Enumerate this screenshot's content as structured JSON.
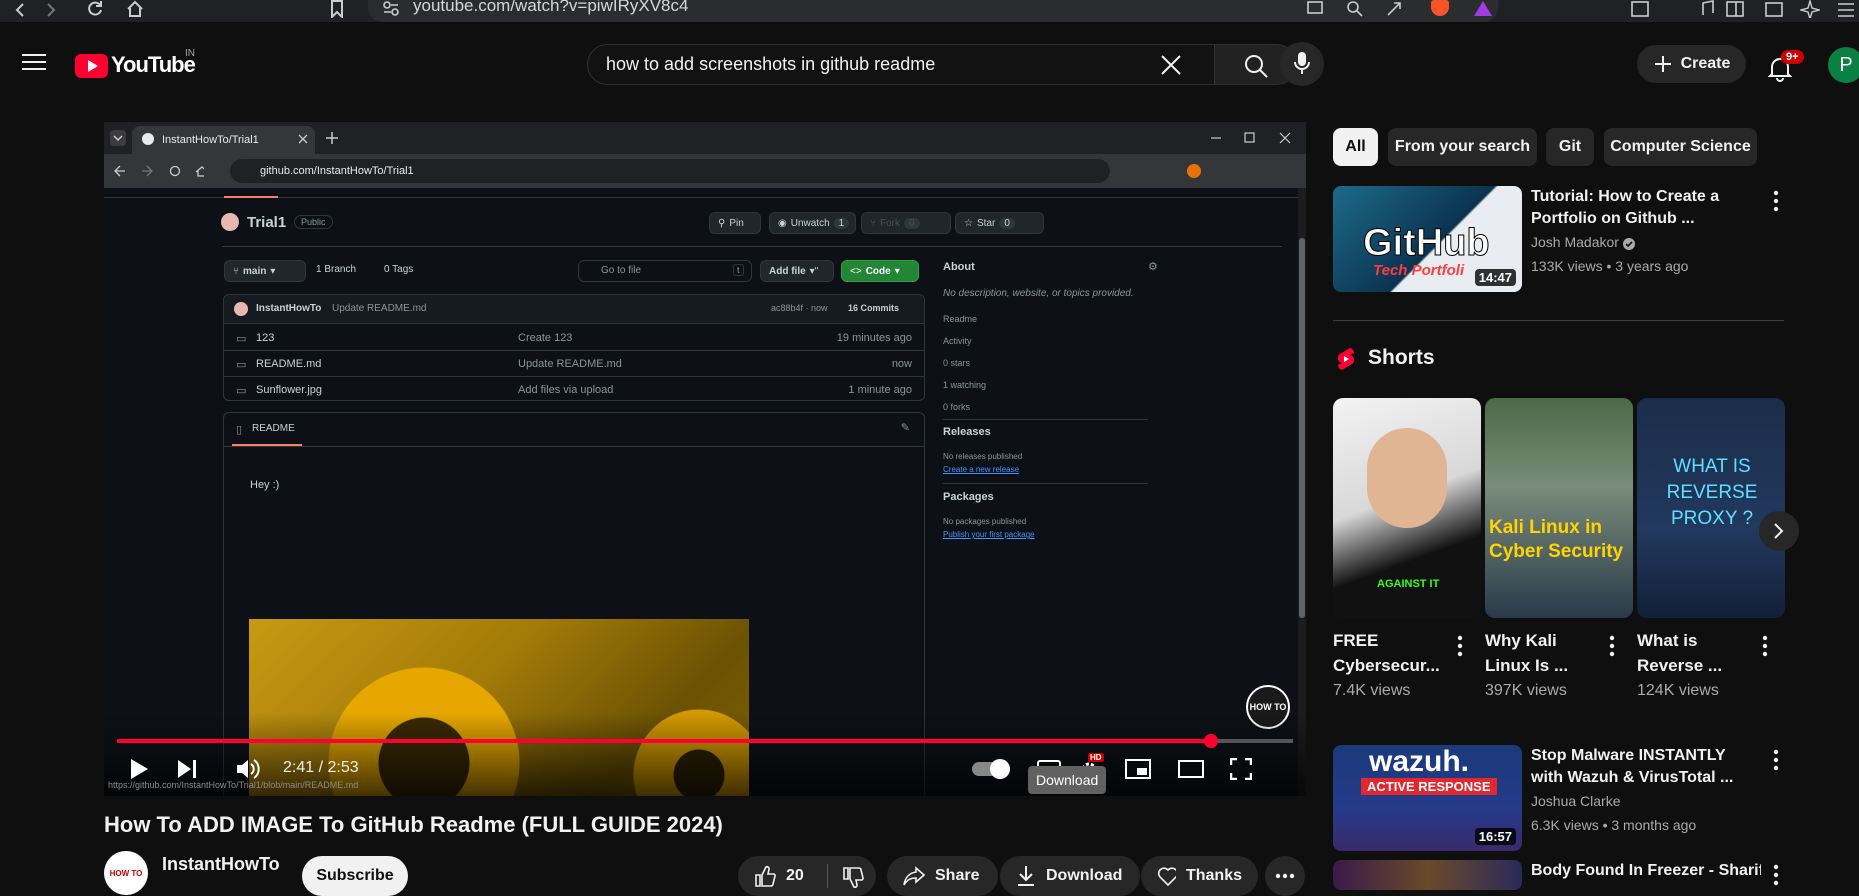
{
  "browser": {
    "url": "youtube.com/watch?v=piwIRyXV8c4"
  },
  "header": {
    "logo_text": "YouTube",
    "region": "IN",
    "search_query": "how to add screenshots in github readme",
    "create_label": "Create",
    "notification_count": "9+",
    "avatar_letter": "P"
  },
  "player": {
    "tab_title": "InstantHowTo/Trial1",
    "address": "github.com/InstantHowTo/Trial1",
    "time": "2:41 / 2:53",
    "progress": 0.93,
    "tooltip": "Download",
    "status_url": "https://github.com/InstantHowTo/Trial1/blob/main/README.md",
    "hd_badge": "HD",
    "watermark": "HOW TO",
    "repo": {
      "name": "Trial1",
      "visibility": "Public",
      "pin": "Pin",
      "unwatch": "Unwatch",
      "unwatch_count": "1",
      "fork": "Fork",
      "fork_count": "0",
      "star": "Star",
      "star_count": "0",
      "branch": "main",
      "branches": "1 Branch",
      "tags": "0 Tags",
      "go_to_file": "Go to file",
      "go_to_file_key": "t",
      "add_file": "Add file",
      "code": "Code",
      "last_commit_author": "InstantHowTo",
      "last_commit_message": "Update README.md",
      "last_commit_meta": "ac88b4f · now",
      "commits": "16 Commits",
      "files": [
        {
          "name": "123",
          "message": "Create 123",
          "time": "19 minutes ago"
        },
        {
          "name": "README.md",
          "message": "Update README.md",
          "time": "now"
        },
        {
          "name": "Sunflower.jpg",
          "message": "Add files via upload",
          "time": "1 minute ago"
        }
      ],
      "readme_tab": "README",
      "readme_text": "Hey :)",
      "about_title": "About",
      "about_desc": "No description, website, or topics provided.",
      "about_items": [
        "Readme",
        "Activity",
        "0 stars",
        "1 watching",
        "0 forks"
      ],
      "releases_title": "Releases",
      "releases_text": "No releases published",
      "releases_link": "Create a new release",
      "packages_title": "Packages",
      "packages_text": "No packages published",
      "packages_link": "Publish your first package"
    }
  },
  "video": {
    "title": "How To ADD IMAGE To GitHub Readme (FULL GUIDE 2024)",
    "channel": "InstantHowTo",
    "subscribe": "Subscribe",
    "likes": "20",
    "share": "Share",
    "download": "Download",
    "thanks": "Thanks"
  },
  "sidebar": {
    "chips": [
      "All",
      "From your search",
      "Git",
      "Computer Science"
    ],
    "videos": [
      {
        "title": "Tutorial: How to Create a Portfolio on Github ...",
        "channel": "Josh Madakor",
        "meta": "133K views • 3 years ago",
        "duration": "14:47",
        "thumb_text": "GitHub",
        "thumb_sub": "Tech Portfoli"
      },
      {
        "title": "Stop Malware INSTANTLY with Wazuh & VirusTotal ...",
        "channel": "Joshua Clarke",
        "meta": "6.3K views • 3 months ago",
        "duration": "16:57",
        "thumb_text": "wazuh.",
        "thumb_sub": "ACTIVE RESPONSE"
      },
      {
        "title": "Body Found In Freezer - Shariful"
      }
    ],
    "shorts_title": "Shorts",
    "shorts": [
      {
        "title": "FREE Cybersecur...",
        "views": "7.4K views",
        "overlay": "AGAINST IT"
      },
      {
        "title": "Why Kali Linux Is ...",
        "views": "397K views",
        "overlay": "Kali Linux in Cyber Security"
      },
      {
        "title": "What is Reverse ...",
        "views": "124K views",
        "overlay": "WHAT IS REVERSE PROXY ?"
      }
    ]
  },
  "colors": {
    "background": "#0f0f0f",
    "accent_red": "#ff0033",
    "github_bg": "#0d1117",
    "github_green": "#238636"
  }
}
